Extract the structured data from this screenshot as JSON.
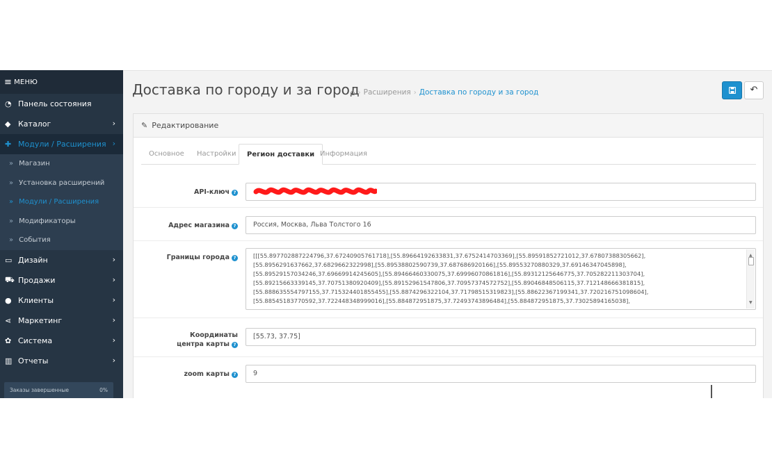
{
  "sidebar": {
    "menu_label": "МЕНЮ",
    "items": [
      {
        "label": "Панель состояния",
        "icon": "dashboard-icon"
      },
      {
        "label": "Каталог",
        "icon": "tag-icon"
      },
      {
        "label": "Модули / Расширения",
        "icon": "puzzle-icon"
      },
      {
        "label": "Дизайн",
        "icon": "monitor-icon"
      },
      {
        "label": "Продажи",
        "icon": "cart-icon"
      },
      {
        "label": "Клиенты",
        "icon": "user-icon"
      },
      {
        "label": "Маркетинг",
        "icon": "share-icon"
      },
      {
        "label": "Система",
        "icon": "gear-icon"
      },
      {
        "label": "Отчеты",
        "icon": "bar-chart-icon"
      }
    ],
    "subitems": [
      "Магазин",
      "Установка расширений",
      "Модули / Расширения",
      "Модификаторы",
      "События"
    ],
    "progress": {
      "label": "Заказы завершенные",
      "value": "0%"
    }
  },
  "header": {
    "title": "Доставка по городу и за город",
    "breadcrumb": [
      "Расширения",
      "Доставка по городу и за город"
    ]
  },
  "panel": {
    "heading": "Редактирование",
    "tabs": [
      "Основное",
      "Настройки",
      "Регион доставки",
      "Информация"
    ],
    "active_tab": "Регион доставки"
  },
  "form": {
    "api_key": {
      "label": "API-ключ",
      "value": ""
    },
    "address": {
      "label": "Адрес магазина",
      "value": "Россия, Москва, Льва Толстого 16"
    },
    "bounds": {
      "label": "Границы города",
      "lines": [
        "[[[55.897702887224796,37.67240905761718],[55.89664192633831,37.6752414703369],[55.89591852721012,37.67807388305662],",
        "[55.8956291637662,37.6829662322998],[55.89538802590739,37.687686920166],[55.89553270880329,37.69146347045898],",
        "[55.89529157034246,37.69669914245605],[55.89466460330075,37.69996070861816],[55.89312125646775,37.705282211303704],",
        "[55.89215663339145,37.70751380920409],[55.89152961547806,37.70957374572752],[55.89046848506115,37.712148666381815],",
        "[55.888635554797155,37.715324401855455],[55.8874296322104,37.71798515319823],[55.88622367199341,37.720216751098604],",
        "[55.88545183770592,37.722448348999016],[55.884872951875,37.72493743896484],[55.884872951875,37.73025894165038],"
      ]
    },
    "center": {
      "label": "Координаты центра карты",
      "value": "[55.73, 37.75]"
    },
    "zoom": {
      "label": "zoom карты",
      "value": "9"
    }
  },
  "colors": {
    "accent": "#1e91cf",
    "sidebar_bg": "#263544",
    "redaction": "#ff1a1a"
  }
}
